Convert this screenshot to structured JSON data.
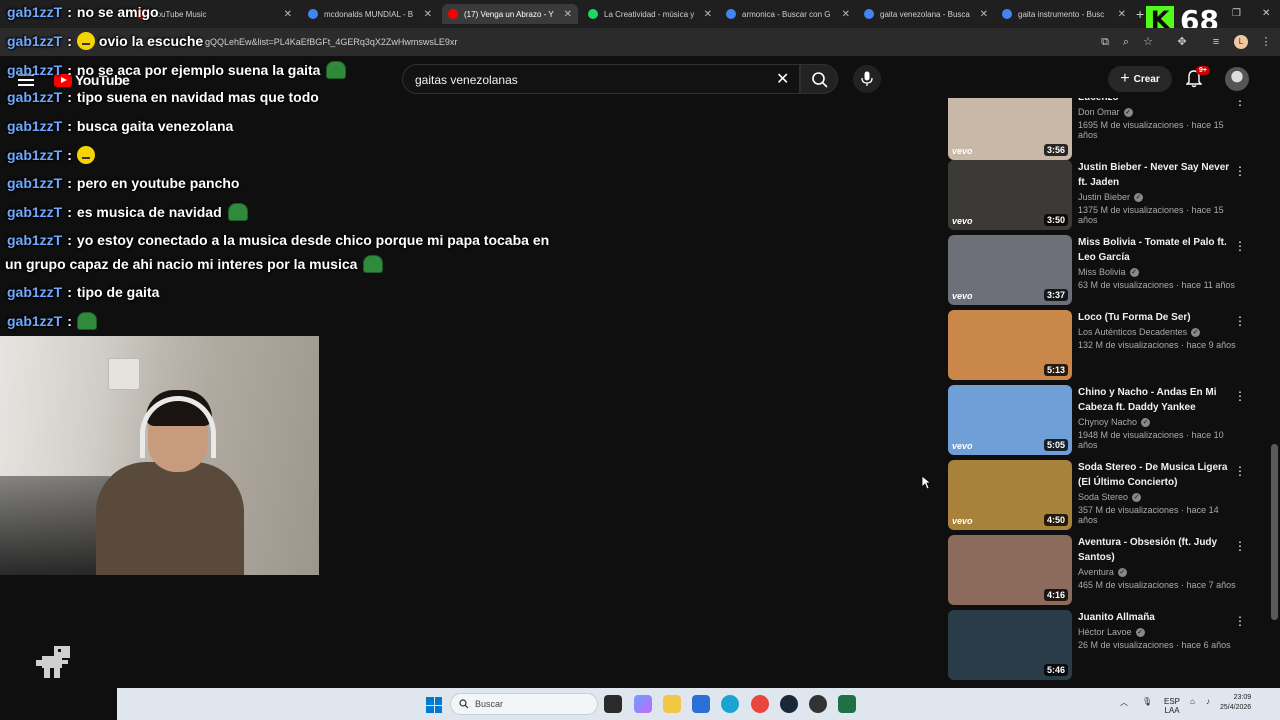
{
  "browser": {
    "tabs": [
      {
        "label": "YouTube Music",
        "icon": "youtube-music-icon"
      },
      {
        "label": "mcdonalds MUNDIAL - B",
        "icon": "google-icon"
      },
      {
        "label": "(17) Venga un Abrazo - Y",
        "icon": "youtube-icon"
      },
      {
        "label": "La Creatividad - música y",
        "icon": "spotify-icon"
      },
      {
        "label": "armonica - Buscar con G",
        "icon": "google-icon"
      },
      {
        "label": "gaita venezolana - Busca",
        "icon": "google-icon"
      },
      {
        "label": "gaita instrumento - Busc",
        "icon": "google-icon"
      }
    ],
    "new_tab": "+",
    "url": "gQQLehEw&list=PL4KaEfBGFt_4GERq3qX2ZwHwmswsLE9xr",
    "profile_initial": "L",
    "window_controls": [
      "–",
      "❐",
      "✕"
    ]
  },
  "stream_overlay": {
    "viewer_count": "68",
    "platform_logo": "K"
  },
  "youtube": {
    "logo_text": "YouTube",
    "search_query": "gaitas venezolanas",
    "create_label": "Crear",
    "notification_badge": "9+"
  },
  "chat": [
    {
      "user": "gab1zzT",
      "text": "no se amigo"
    },
    {
      "user": "gab1zzT",
      "text": "ovio la escuche"
    },
    {
      "user": "gab1zzT",
      "text": "no se aca por ejemplo suena la gaita"
    },
    {
      "user": "gab1zzT",
      "text": "tipo suena en navidad mas que todo"
    },
    {
      "user": "gab1zzT",
      "text": "busca gaita venezolana"
    },
    {
      "user": "gab1zzT",
      "text": ""
    },
    {
      "user": "gab1zzT",
      "text": "pero en youtube pancho"
    },
    {
      "user": "gab1zzT",
      "text": "es musica de navidad"
    },
    {
      "user": "gab1zzT",
      "text": "yo estoy conectado a la musica desde chico porque mi papa tocaba en"
    },
    {
      "user": "",
      "text": "un grupo capaz de ahi nacio mi interes por la musica"
    },
    {
      "user": "gab1zzT",
      "text": "tipo de gaita"
    },
    {
      "user": "gab1zzT",
      "text": ""
    }
  ],
  "videos": [
    {
      "title": "Lucenzo",
      "channel": "Don Omar",
      "stats": "1695 M de visualizaciones · hace 15 años",
      "duration": "3:56",
      "vevo": "vevo",
      "color": "#c7b8a8"
    },
    {
      "title": "Justin Bieber - Never Say Never ft. Jaden",
      "channel": "Justin Bieber",
      "stats": "1375 M de visualizaciones · hace 15 años",
      "duration": "3:50",
      "vevo": "vevo",
      "color": "#3c3a36"
    },
    {
      "title": "Miss Bolivia - Tomate el Palo ft. Leo García",
      "channel": "Miss Bolivia",
      "stats": "63 M de visualizaciones · hace 11 años",
      "duration": "3:37",
      "vevo": "vevo",
      "color": "#6d7078"
    },
    {
      "title": "Loco (Tu Forma De Ser)",
      "channel": "Los Auténticos Decadentes",
      "stats": "132 M de visualizaciones · hace 9 años",
      "duration": "5:13",
      "vevo": "",
      "color": "#c9884a"
    },
    {
      "title": "Chino y Nacho - Andas En Mi Cabeza ft. Daddy Yankee",
      "channel": "Chynoy Nacho",
      "stats": "1948 M de visualizaciones · hace 10 años",
      "duration": "5:05",
      "vevo": "vevo",
      "color": "#6f9fd6"
    },
    {
      "title": "Soda Stereo - De Musica Ligera (El Último Concierto)",
      "channel": "Soda Stereo",
      "stats": "357 M de visualizaciones · hace 14 años",
      "duration": "4:50",
      "vevo": "vevo",
      "color": "#a8823a"
    },
    {
      "title": "Aventura - Obsesión (ft. Judy Santos)",
      "channel": "Aventura",
      "stats": "465 M de visualizaciones · hace 7 años",
      "duration": "4:16",
      "vevo": "",
      "color": "#8c6a5c"
    },
    {
      "title": "Juanito Allmaña",
      "channel": "Héctor Lavoe",
      "stats": "26 M de visualizaciones · hace 6 años",
      "duration": "5:46",
      "vevo": "",
      "color": "#2a3c48"
    }
  ],
  "taskbar": {
    "search_label": "Buscar",
    "lang_top": "ESP",
    "lang_bottom": "LAA",
    "time": "23:09",
    "date": "25/4/2026"
  }
}
